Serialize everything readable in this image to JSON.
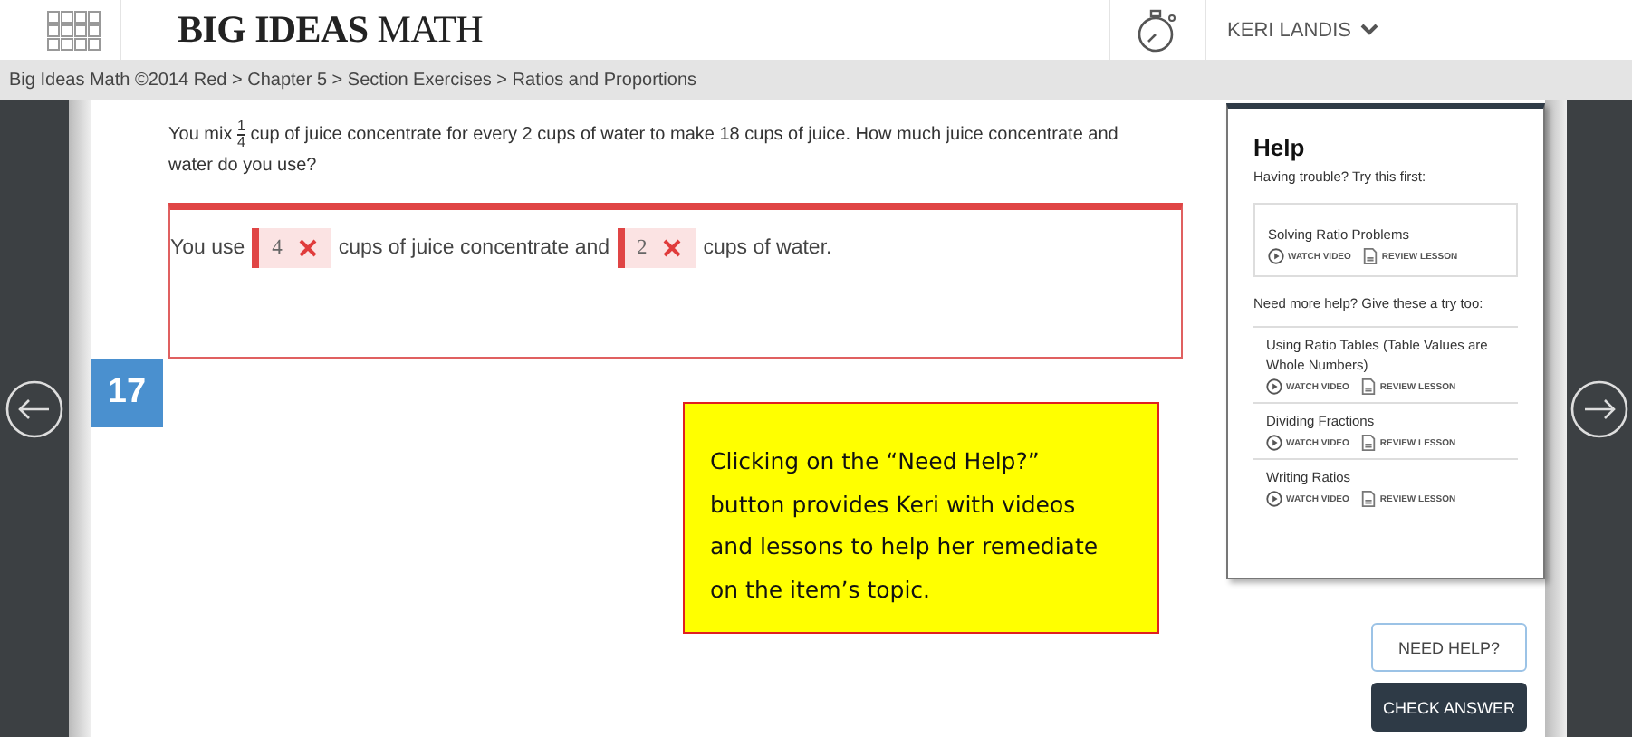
{
  "header": {
    "logo": "**BIG IDEAS** MATH",
    "user": "KERI LANDIS"
  },
  "breadcrumb": "Big Ideas Math ©2014 Red > Chapter 5 > Section Exercises > Ratios and Proportions",
  "question": {
    "before": "You mix",
    "numerator": "1",
    "denominator": "4",
    "after": "cup of juice concentrate for every 2 cups of water to make 18 cups of juice. How much juice concentrate and water do you use?"
  },
  "answer": [
    {
      "kind": "text",
      "text": "You use"
    },
    {
      "kind": "blank",
      "value": "4",
      "correct": false
    },
    {
      "kind": "text",
      "text": "cups of juice concentrate and"
    },
    {
      "kind": "blank",
      "value": "2",
      "correct": false
    },
    {
      "kind": "text",
      "text": "cups of water."
    }
  ],
  "item_number": "17",
  "help": {
    "title": "Help",
    "first_prompt": "Having trouble? Try this first:",
    "first": {
      "title": "Solving Ratio Problems",
      "video": "WATCH VIDEO",
      "lesson": "REVIEW LESSON"
    },
    "more_prompt": "Need more help? Give these a try too:",
    "more": [
      {
        "title": "Using Ratio Tables (Table Values are Whole Numbers)",
        "video": "WATCH VIDEO",
        "lesson": "REVIEW LESSON"
      },
      {
        "title": "Dividing Fractions",
        "video": "WATCH VIDEO",
        "lesson": "REVIEW LESSON"
      },
      {
        "title": "Writing Ratios",
        "video": "WATCH VIDEO",
        "lesson": "REVIEW LESSON"
      }
    ]
  },
  "callout": "Clicking on the “Need Help?” button provides Keri with videos and lessons to help her remediate on the item’s topic.",
  "buttons": [
    {
      "label": "NEED HELP?",
      "kind": "outline"
    },
    {
      "label": "CHECK ANSWER",
      "kind": "primary"
    }
  ]
}
